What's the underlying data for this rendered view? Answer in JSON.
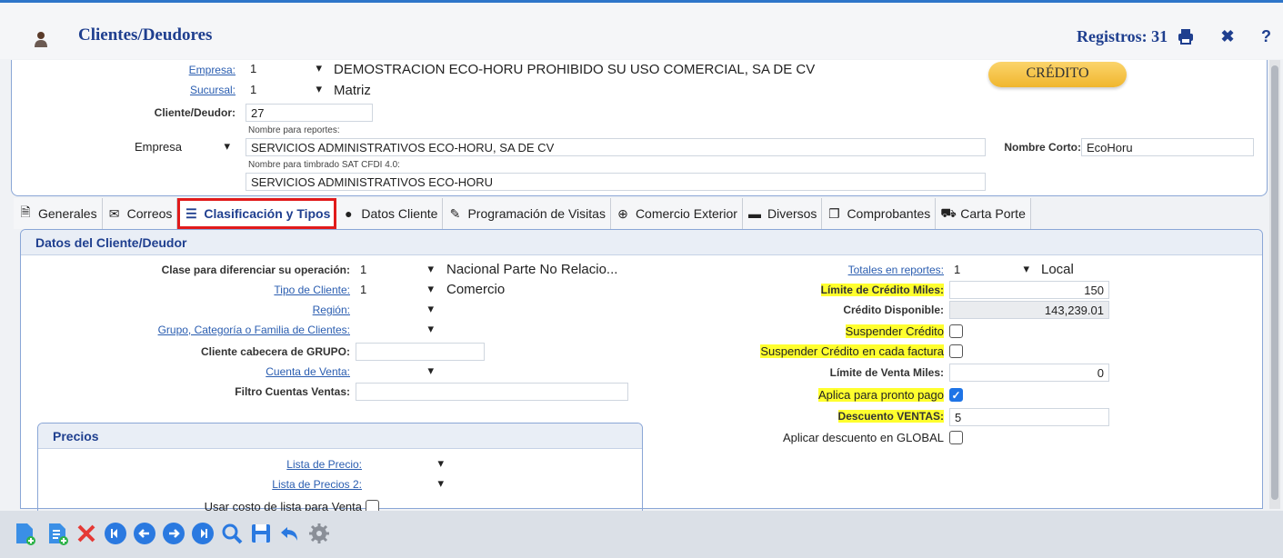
{
  "window": {
    "title": "Clientes/Deudores",
    "registros": "Registros: 31"
  },
  "header": {
    "empresa_label": "Empresa:",
    "empresa_value": "1",
    "empresa_name": "DEMOSTRACION ECO-HORU PROHIBIDO SU USO COMERCIAL, SA DE CV",
    "sucursal_label": "Sucursal:",
    "sucursal_value": "1",
    "sucursal_name": "Matriz",
    "cliente_label": "Cliente/Deudor:",
    "cliente_value": "27",
    "nombre_reportes_label": "Nombre para reportes:",
    "tipo_nombre": "Empresa",
    "nombre_reportes_value": "SERVICIOS ADMINISTRATIVOS ECO-HORU, SA DE CV",
    "nombre_corto_label": "Nombre Corto:",
    "nombre_corto_value": "EcoHoru",
    "nombre_timbrado_label": "Nombre para timbrado SAT CFDI 4.0:",
    "nombre_timbrado_value": "SERVICIOS ADMINISTRATIVOS ECO-HORU",
    "credito_badge": "CRÉDITO"
  },
  "tabs": [
    {
      "label": "Generales",
      "icon": "document-icon"
    },
    {
      "label": "Correos",
      "icon": "envelope-icon"
    },
    {
      "label": "Clasificación y Tipos",
      "icon": "list-icon"
    },
    {
      "label": "Datos Cliente",
      "icon": "user-icon"
    },
    {
      "label": "Programación de Visitas",
      "icon": "edit-icon"
    },
    {
      "label": "Comercio Exterior",
      "icon": "globe-icon"
    },
    {
      "label": "Diversos",
      "icon": "archive-icon"
    },
    {
      "label": "Comprobantes",
      "icon": "copy-icon"
    },
    {
      "label": "Carta Porte",
      "icon": "truck-icon"
    }
  ],
  "datos": {
    "section_title": "Datos del Cliente/Deudor",
    "clase_label": "Clase para diferenciar su operación:",
    "clase_value": "1",
    "clase_name": "Nacional Parte No Relacio...",
    "tipo_cliente_label": "Tipo de Cliente:",
    "tipo_cliente_value": "1",
    "tipo_cliente_name": "Comercio",
    "region_label": "Región:",
    "grupo_label": "Grupo, Categoría o Familia de Clientes:",
    "cabecera_label": "Cliente cabecera de GRUPO:",
    "cuenta_venta_label": "Cuenta de Venta:",
    "filtro_label": "Filtro Cuentas Ventas:",
    "totales_label": "Totales en reportes:",
    "totales_value": "1",
    "totales_name": "Local",
    "limite_credito_label": "Límite de Crédito Miles:",
    "limite_credito_value": "150",
    "credito_disp_label": "Crédito Disponible:",
    "credito_disp_value": "143,239.01",
    "suspender_label": "Suspender Crédito",
    "suspender_factura_label": "Suspender Crédito en cada factura",
    "limite_venta_label": "Límite de Venta Miles:",
    "limite_venta_value": "0",
    "pronto_pago_label": "Aplica para pronto pago",
    "descuento_label": "Descuento VENTAS:",
    "descuento_value": "5",
    "desc_global_label": "Aplicar descuento en GLOBAL"
  },
  "precios": {
    "title": "Precios",
    "lista_label": "Lista de Precio:",
    "lista2_label": "Lista de Precios 2:",
    "usar_costo_label": "Usar costo de lista para Venta"
  },
  "toolbar_icons": [
    "new-doc-icon",
    "new-list-icon",
    "delete-icon",
    "first-icon",
    "prev-icon",
    "next-icon",
    "last-icon",
    "search-icon",
    "save-icon",
    "undo-icon",
    "settings-icon"
  ]
}
